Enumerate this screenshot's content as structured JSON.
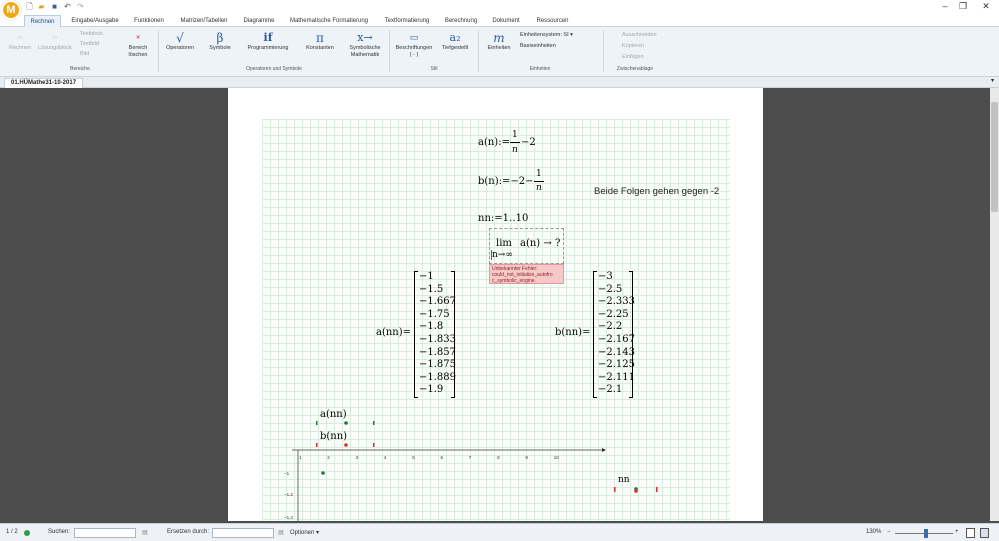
{
  "app": {
    "logo": "M"
  },
  "window_controls": {
    "minimize": "–",
    "restore": "❐",
    "close": "✕"
  },
  "quickaccess": [
    "new-doc-icon",
    "open-folder-icon",
    "save-icon",
    "undo-icon",
    "redo-icon"
  ],
  "tabs": [
    "Rechnen",
    "Eingabe/Ausgabe",
    "Funktionen",
    "Matrizen/Tabellen",
    "Diagramme",
    "Mathematische Formatierung",
    "Textformatierung",
    "Berechnung",
    "Dokument",
    "Ressourcen"
  ],
  "ribbon": {
    "rechnen": "Rechnen",
    "loesungsblock": "Lösungsblock",
    "textblock": "Textblock",
    "textfeld": "Textfeld",
    "bild": "Bild",
    "bereich_loeschen": "Bereich löschen",
    "group_bereiche": "Bereiche",
    "operatoren": "Operatoren",
    "symbole": "Symbole",
    "programmierung": "Programmierung",
    "konstanten": "Konstanten",
    "symbolische_mathematik": "Symbolische Mathematik",
    "group_operatoren": "Operatoren und Symbole",
    "beschriftungen": "Beschriftungen",
    "beschriftungen_val": "( - )",
    "tiefgestellt": "Tiefgestellt",
    "group_stil": "Stil",
    "einheiten": "Einheiten",
    "einheitensystem": "Einheitensystem:",
    "einheitensystem_val": "SI",
    "basiseinheiten": "Basiseinheiten",
    "group_einheiten": "Einheiten",
    "ausschneiden": "Ausschneiden",
    "kopieren": "Kopieren",
    "einfuegen": "Einfügen",
    "group_zwischenablage": "Zwischenablage",
    "icons": {
      "operatoren": "√",
      "symbole": "β",
      "programmierung": "if",
      "konstanten": "π",
      "symbolische": "x→",
      "tiefgestellt": "a₂",
      "einheiten": "m"
    }
  },
  "document": {
    "tab_title": "01.HÜMathe31-10-2017"
  },
  "worksheet": {
    "def_a_lhs": "a(n):=",
    "def_a_num": "1",
    "def_a_den": "n",
    "def_a_tail": "−2",
    "def_b_lhs": "b(n):=−2−",
    "def_b_num": "1",
    "def_b_den": "n",
    "text_note": "Beide Folgen gehen gegen -2",
    "range_def": "nn:=1‥10",
    "lim_word": "lim",
    "lim_expr": "a(n) → ?",
    "lim_sub": "n→∞",
    "error_text": "Unbekannter Fehler: could_not_initialize_autofro c_symbolic_engine.",
    "a_label": "a(nn)=",
    "a_values": [
      "−1",
      "−1.5",
      "−1.667",
      "−1.75",
      "−1.8",
      "−1.833",
      "−1.857",
      "−1.875",
      "−1.889",
      "−1.9"
    ],
    "b_label": "b(nn)=",
    "b_values": [
      "−3",
      "−2.5",
      "−2.333",
      "−2.25",
      "−2.2",
      "−2.167",
      "−2.143",
      "−2.125",
      "−2.111",
      "−2.1"
    ],
    "plot_legend_a": "a(nn)",
    "plot_legend_b": "b(nn)",
    "plot_xlabel": "nn",
    "plot_xticks": [
      "1",
      "2",
      "3",
      "4",
      "5",
      "6",
      "7",
      "8",
      "9",
      "10"
    ],
    "plot_yticks": [
      "−1",
      "−1.2",
      "−1.4"
    ],
    "series_a_color": "#1e7a3c",
    "series_b_color": "#d32f2f"
  },
  "status": {
    "page": "1 / 2",
    "suchen": "Suchen:",
    "ersetzen": "Ersetzen durch:",
    "optionen": "Optionen",
    "zoom": "130%",
    "zoom_minus": "−",
    "zoom_plus": "+"
  }
}
